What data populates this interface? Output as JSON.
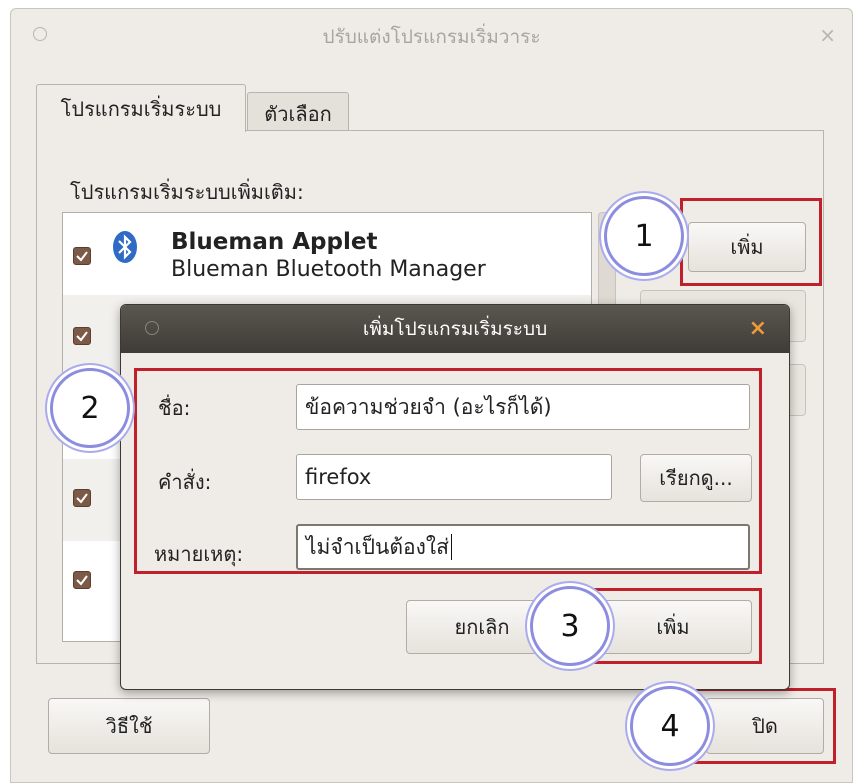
{
  "window": {
    "title": "ปรับแต่งโปรแกรมเริ่มวาระ",
    "close_glyph": "×",
    "tabs": [
      {
        "label": "โปรแกรมเริ่มระบบ",
        "active": true
      },
      {
        "label": "ตัวเลือก",
        "active": false
      }
    ],
    "section_label": "โปรแกรมเริ่มระบบเพิ่มเติม:",
    "startup_list": [
      {
        "checked": true,
        "icon": "bluetooth-icon",
        "name": "Blueman Applet",
        "description": "Blueman Bluetooth Manager"
      },
      {
        "checked": true
      },
      {
        "checked": true
      },
      {
        "checked": true
      },
      {
        "checked": true
      }
    ],
    "add_button": "เพิ่ม",
    "help_button": "วิธีใช้",
    "close_button": "ปิด"
  },
  "dialog": {
    "title": "เพิ่มโปรแกรมเริ่มระบบ",
    "close_glyph": "×",
    "name_label": "ชื่อ:",
    "name_value": "ข้อความช่วยจำ (อะไรก็ได้)",
    "command_label": "คำสั่ง:",
    "command_value": "firefox",
    "browse_button": "เรียกดู...",
    "comment_label": "หมายเหตุ:",
    "comment_value": "ไม่จำเป็นต้องใส่",
    "cancel_button": "ยกเลิก",
    "add_button": "เพิ่ม"
  },
  "annotations": [
    {
      "number": "1"
    },
    {
      "number": "2"
    },
    {
      "number": "3"
    },
    {
      "number": "4"
    }
  ],
  "colors": {
    "highlight_box": "#c0202a",
    "checkbox": "#7b5a47",
    "dialog_titlebar": "#4a4741",
    "dialog_close": "#f19a3a",
    "cloud_outline": "#8c8ce0"
  }
}
